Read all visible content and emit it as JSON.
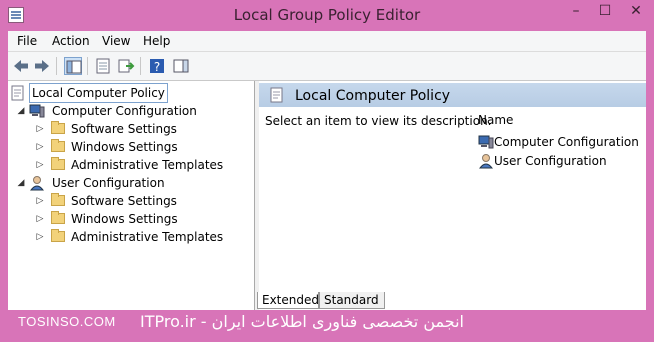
{
  "window": {
    "title": "Local Group Policy Editor",
    "min_label": "–",
    "max_label": "☐",
    "close_label": "✕"
  },
  "menubar": {
    "items": [
      "File",
      "Action",
      "View",
      "Help"
    ]
  },
  "toolbar": {
    "buttons": [
      "back-icon",
      "forward-icon",
      "show-hide-tree-icon",
      "export-list-icon",
      "properties-icon",
      "help-icon",
      "show-action-pane-icon"
    ]
  },
  "tree": {
    "root": "Local Computer Policy",
    "nodes": [
      {
        "label": "Computer Configuration",
        "children": [
          "Software Settings",
          "Windows Settings",
          "Administrative Templates"
        ]
      },
      {
        "label": "User Configuration",
        "children": [
          "Software Settings",
          "Windows Settings",
          "Administrative Templates"
        ]
      }
    ]
  },
  "details": {
    "header": "Local Computer Policy",
    "description": "Select an item to view its description.",
    "column_name": "Name",
    "items": [
      "Computer Configuration",
      "User Configuration"
    ]
  },
  "tabs": [
    "Extended",
    "Standard"
  ],
  "watermark": {
    "left": "TOSINSO.COM",
    "right": "ITPro.ir - انجمن تخصصی فناوری اطلاعات ایران"
  },
  "colors": {
    "frame": "#d874b8",
    "header_band": "#bcd0e6"
  }
}
